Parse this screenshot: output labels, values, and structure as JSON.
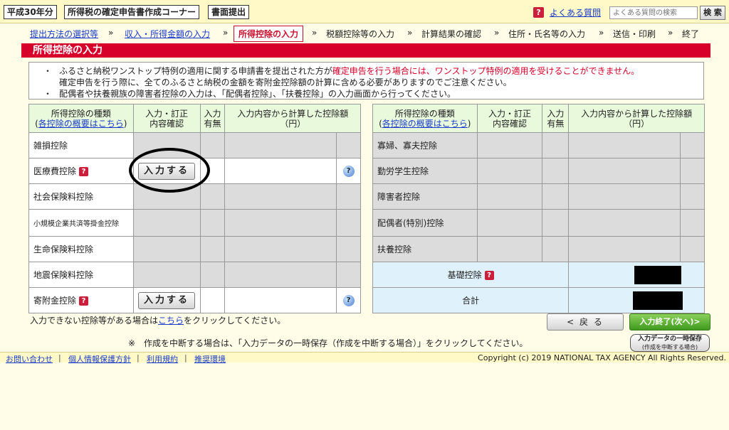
{
  "header": {
    "year_tag": "平成30年分",
    "title_tag": "所得税の確定申告書作成コーナー",
    "submit_tag": "書面提出",
    "help_icon": "question-icon",
    "faq_link": "よくある質問",
    "search_placeholder": "よくある質問の検索",
    "search_button": "検 索"
  },
  "breadcrumb": {
    "steps": [
      "提出方法の選択等",
      "収入・所得金額の入力",
      "所得控除の入力",
      "税額控除等の入力",
      "計算結果の確認",
      "住所・氏名等の入力",
      "送信・印刷",
      "終了"
    ],
    "separator": "»"
  },
  "section": {
    "title": "所得控除の入力"
  },
  "notes": {
    "bullet": "・",
    "line1_prefix": "ふるさと納税ワンストップ特例の適用に関する申請書を提出された方が",
    "line1_red": "確定申告を行う場合には、ワンストップ特例の適用を受けることができません。",
    "line2": "確定申告を行う際に、全てのふるさと納税の金額を寄附金控除額の計算に含める必要がありますのでご注意ください。",
    "line3": "配偶者や扶養親族の障害者控除の入力は、「配偶者控除」、「扶養控除」の入力画面から行ってください。"
  },
  "left_table": {
    "headers": {
      "type_line1": "所得控除の種類",
      "type_open": "(",
      "type_link": "各控除の概要はこちら",
      "type_close": ")",
      "input_line1": "入力・訂正",
      "input_line2": "内容確認",
      "exists_line1": "入力",
      "exists_line2": "有無",
      "amount": "入力内容から計算した控除額（円）"
    },
    "rows": [
      {
        "name": "雑損控除",
        "help": false,
        "button": ""
      },
      {
        "name": "医療費控除",
        "help": true,
        "button": "入力する"
      },
      {
        "name": "社会保険料控除",
        "help": false,
        "button": ""
      },
      {
        "name": "小規模企業共済等掛金控除",
        "help": false,
        "button": ""
      },
      {
        "name": "生命保険料控除",
        "help": false,
        "button": ""
      },
      {
        "name": "地震保険料控除",
        "help": false,
        "button": ""
      },
      {
        "name": "寄附金控除",
        "help": true,
        "button": "入力する"
      }
    ],
    "help_icon": "?"
  },
  "right_table": {
    "headers": {
      "type_line1": "所得控除の種類",
      "type_open": "(",
      "type_link": "各控除の概要はこちら",
      "type_close": ")",
      "input_line1": "入力・訂正",
      "input_line2": "内容確認",
      "exists_line1": "入力",
      "exists_line2": "有無",
      "amount": "入力内容から計算した控除額（円）"
    },
    "rows": [
      {
        "name": "寡婦、寡夫控除"
      },
      {
        "name": "勤労学生控除"
      },
      {
        "name": "障害者控除"
      },
      {
        "name": "配偶者(特別)控除"
      },
      {
        "name": "扶養控除"
      }
    ],
    "basic": "基礎控除",
    "total": "合計"
  },
  "bottom": {
    "cant_prefix": "入力できない控除等がある場合は",
    "cant_link": "こちら",
    "cant_suffix": "をクリックしてください。",
    "back_button": "< 戻 る",
    "next_button": "入力終了(次へ)>",
    "suspend_note": "※　作成を中断する場合は、「入力データの一時保存（作成を中断する場合）」をクリックしてください。",
    "save_line1": "入力データの一時保存",
    "save_line2": "(作成を中断する場合)"
  },
  "footer": {
    "links": [
      "お問い合わせ",
      "個人情報保護方針",
      "利用規約",
      "推奨環境"
    ],
    "separator": "|",
    "copyright": "Copyright (c) 2019 NATIONAL TAX AGENCY All Rights Reserved."
  },
  "colors": {
    "accent_red": "#d6002a",
    "header_yellow": "#fff9c8",
    "table_header_green": "#e9f9dc",
    "disabled_gray": "#dcdcdc",
    "summary_blue": "#dff1fb",
    "link_blue": "#1a3cc8"
  }
}
